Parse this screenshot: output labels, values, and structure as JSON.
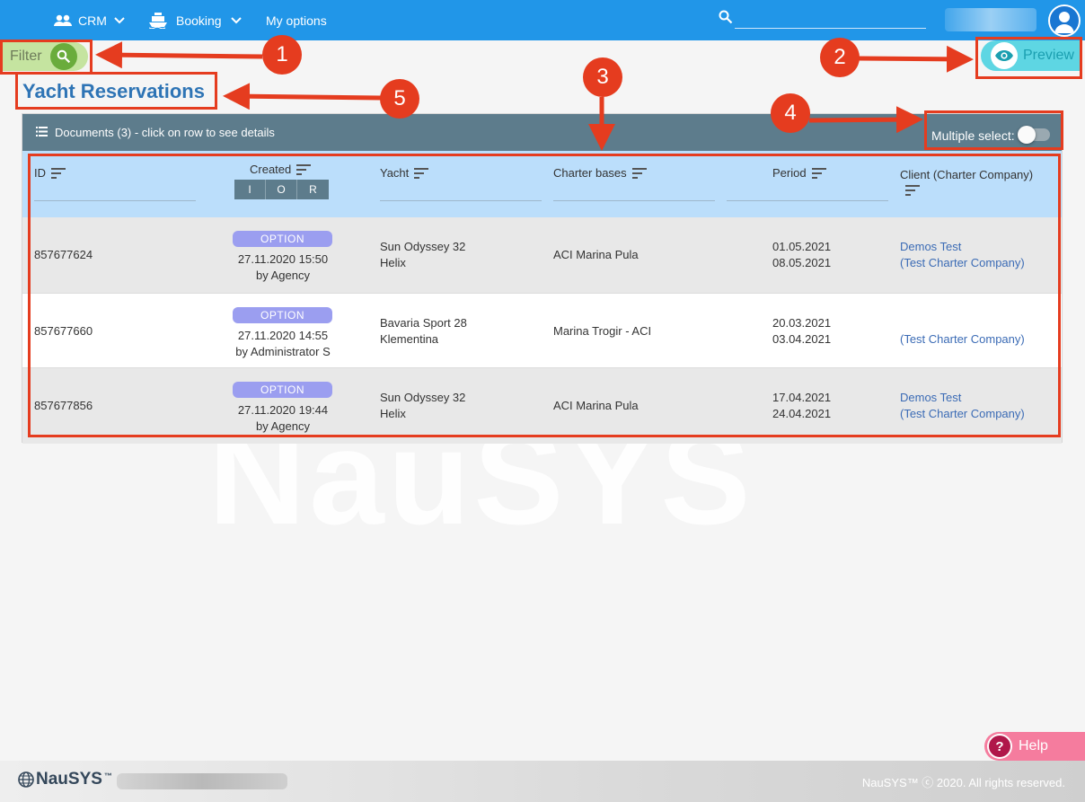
{
  "nav": {
    "crm_label": "CRM",
    "booking_label": "Booking",
    "options_label": "My options",
    "search_icon": "search-icon",
    "avatar_icon": "user-icon"
  },
  "toolbar": {
    "filter_label": "Filter",
    "preview_label": "Preview"
  },
  "page": {
    "title": "Yacht Reservations",
    "watermark": "NauSYS"
  },
  "documents": {
    "header_text": "Documents (3) - click on row to see details",
    "multiple_select_label": "Multiple select:",
    "multiple_select_on": false
  },
  "table": {
    "columns": [
      {
        "key": "id",
        "label": "ID"
      },
      {
        "key": "created",
        "label": "Created"
      },
      {
        "key": "yacht",
        "label": "Yacht"
      },
      {
        "key": "base",
        "label": "Charter bases"
      },
      {
        "key": "period",
        "label": "Period"
      },
      {
        "key": "client",
        "label": "Client (Charter Company)"
      }
    ],
    "created_filters": [
      "I",
      "O",
      "R"
    ],
    "rows": [
      {
        "id": "857677624",
        "status": "OPTION",
        "created_date": "27.11.2020 15:50",
        "created_by": "by Agency",
        "yacht_model": "Sun Odyssey 32",
        "yacht_name": "Helix",
        "base": "ACI Marina Pula",
        "period_from": "01.05.2021",
        "period_to": "08.05.2021",
        "client_name": "Demos Test",
        "client_company": "(Test Charter Company)"
      },
      {
        "id": "857677660",
        "status": "OPTION",
        "created_date": "27.11.2020 14:55",
        "created_by": "by Administrator S",
        "yacht_model": "Bavaria Sport 28",
        "yacht_name": "Klementina",
        "base": "Marina Trogir - ACI",
        "period_from": "20.03.2021",
        "period_to": "03.04.2021",
        "client_name": "",
        "client_company": "(Test Charter Company)"
      },
      {
        "id": "857677856",
        "status": "OPTION",
        "created_date": "27.11.2020 19:44",
        "created_by": "by Agency",
        "yacht_model": "Sun Odyssey 32",
        "yacht_name": "Helix",
        "base": "ACI Marina Pula",
        "period_from": "17.04.2021",
        "period_to": "24.04.2021",
        "client_name": "Demos Test",
        "client_company": "(Test Charter Company)"
      }
    ]
  },
  "annotations": [
    "1",
    "2",
    "3",
    "4",
    "5"
  ],
  "help": {
    "label": "Help",
    "icon": "?"
  },
  "footer": {
    "logo_text": "NauSYS",
    "logo_tm": "™",
    "copyright": "NauSYS™ ⓒ 2020. All rights reserved."
  },
  "colors": {
    "nav": "#2196e8",
    "filter": "#c5e4a0",
    "preview": "#5ed6e3",
    "title": "#2e74b5",
    "panel_header": "#5d7c8c",
    "table_header": "#bbdefb",
    "badge": "#9b9ef0",
    "annotation": "#e53c1f",
    "help": "#f57c9e"
  }
}
